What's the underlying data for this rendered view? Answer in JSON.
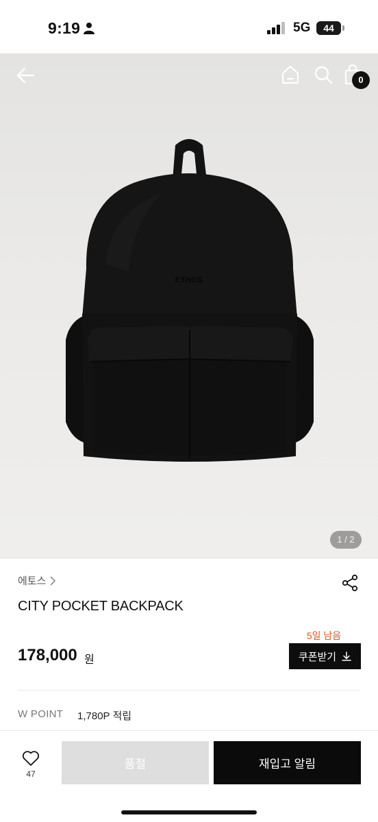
{
  "status_bar": {
    "time": "9:19",
    "network": "5G",
    "battery": "44"
  },
  "header": {
    "icons": [
      "back-icon",
      "home-icon",
      "search-icon",
      "shopping-bag-icon"
    ],
    "cart_count": "0"
  },
  "gallery": {
    "pager": "1 / 2",
    "image_logo_text": "ETHOS"
  },
  "product": {
    "brand": "에토스",
    "title": "CITY POCKET BACKPACK",
    "price": "178,000",
    "price_unit": "원",
    "coupon_deadline": "5일 남음",
    "coupon_label": "쿠폰받기",
    "points_label": "W POINT",
    "points_value": "1,780P 적립"
  },
  "actions": {
    "like_count": "47",
    "soldout_label": "품절",
    "restock_label": "재입고 알림"
  },
  "colors": {
    "accent_orange": "#e0561f",
    "button_dark": "#0b0b0b",
    "button_disabled": "#dedede"
  }
}
